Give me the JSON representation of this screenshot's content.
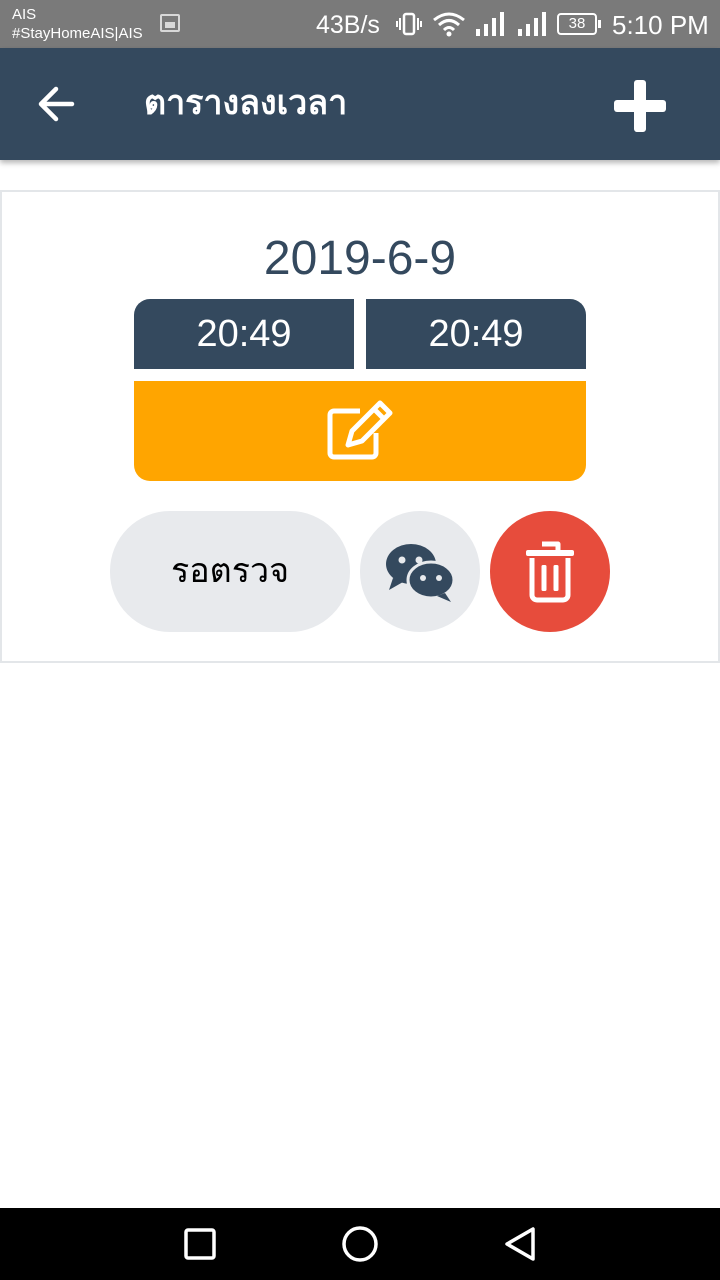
{
  "status_bar": {
    "carrier_line1": "AIS",
    "carrier_line2": "#StayHomeAIS|AIS",
    "net_speed": "43B/s",
    "battery": "38",
    "time": "5:10 PM"
  },
  "app_bar": {
    "title": "ตารางลงเวลา",
    "color": "#34495e"
  },
  "entry": {
    "date": "2019-6-9",
    "start_time": "20:49",
    "end_time": "20:49",
    "status_label": "รอตรวจ",
    "edit_color": "#ffa500",
    "delete_color": "#e74c3c"
  },
  "icons": {
    "back": "arrow-left-icon",
    "add": "plus-icon",
    "edit": "edit-square-icon",
    "chat": "wechat-bubbles-icon",
    "delete": "trash-icon"
  }
}
